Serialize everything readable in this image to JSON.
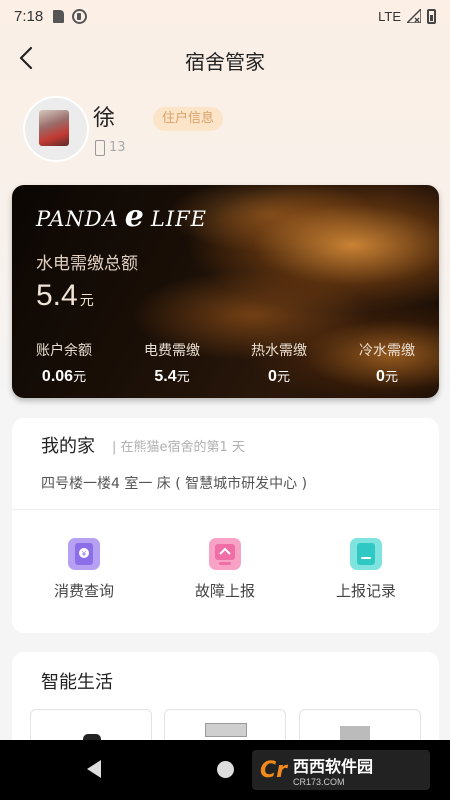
{
  "status_bar": {
    "time": "7:18",
    "network": "LTE"
  },
  "header": {
    "title": "宿舍管家"
  },
  "profile": {
    "name": "徐",
    "info_badge": "住户信息",
    "phone": "13"
  },
  "card": {
    "logo_left": "PANDA",
    "logo_e": "e",
    "logo_right": "LIFE",
    "total_label": "水电需缴总额",
    "total_value": "5.4",
    "total_unit": "元",
    "stats": [
      {
        "label": "账户余额",
        "value": "0.06",
        "unit": "元"
      },
      {
        "label": "电费需缴",
        "value": "5.4",
        "unit": "元"
      },
      {
        "label": "热水需缴",
        "value": "0",
        "unit": "元"
      },
      {
        "label": "冷水需缴",
        "value": "0",
        "unit": "元"
      }
    ]
  },
  "home": {
    "title": "我的家",
    "subtitle": "| 在熊猫e宿舍的第1  天",
    "address": "四号楼一楼4    室一  床 ( 智慧城市研发中心 )",
    "actions": [
      {
        "label": "消费查询",
        "icon": "purchase-query-icon",
        "color": "#a98cf0"
      },
      {
        "label": "故障上报",
        "icon": "fault-report-icon",
        "color": "#f47fb1"
      },
      {
        "label": "上报记录",
        "icon": "report-record-icon",
        "color": "#49d4d0"
      }
    ]
  },
  "smart_life": {
    "title": "智能生活"
  },
  "watermark": {
    "logo": "Cr",
    "main": "西西软件园",
    "sub": "CR173.COM"
  },
  "colors": {
    "accent_badge_bg": "#fbe4c8",
    "accent_badge_text": "#d9a26a",
    "card_bg": "#1a0f07"
  }
}
